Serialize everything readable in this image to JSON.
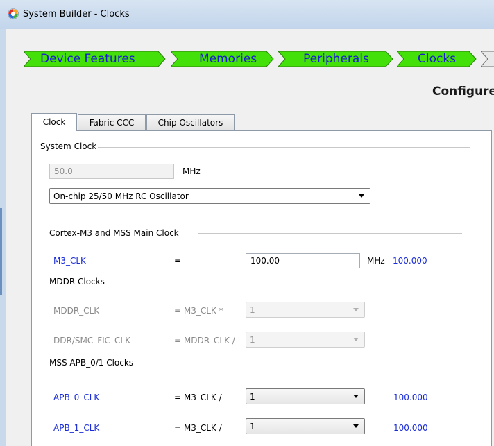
{
  "window": {
    "title": "System Builder - Clocks",
    "icon": "app-logo-icon"
  },
  "wizard": {
    "steps": [
      {
        "label": "Device Features"
      },
      {
        "label": "Memories"
      },
      {
        "label": "Peripherals"
      },
      {
        "label": "Clocks"
      }
    ],
    "heading": "Configure"
  },
  "tabs": [
    {
      "label": "Clock",
      "active": true
    },
    {
      "label": "Fabric CCC"
    },
    {
      "label": "Chip Oscillators"
    }
  ],
  "system_clock": {
    "group_label": "System Clock",
    "frequency_value": "50.0",
    "unit": "MHz",
    "source_selected": "On-chip 25/50 MHz RC Oscillator"
  },
  "m3": {
    "group_label": "Cortex-M3 and MSS Main Clock",
    "name": "M3_CLK",
    "operator": "=",
    "value": "100.00",
    "unit": "MHz",
    "actual": "100.000"
  },
  "mddr": {
    "group_label": "MDDR Clocks",
    "rows": [
      {
        "name": "MDDR_CLK",
        "expr": "= M3_CLK *",
        "selected": "1"
      },
      {
        "name": "DDR/SMC_FIC_CLK",
        "expr": "= MDDR_CLK /",
        "selected": "1"
      }
    ]
  },
  "apb": {
    "group_label": "MSS APB_0/1 Clocks",
    "rows": [
      {
        "name": "APB_0_CLK",
        "expr": "= M3_CLK /",
        "selected": "1",
        "actual": "100.000"
      },
      {
        "name": "APB_1_CLK",
        "expr": "= M3_CLK /",
        "selected": "1",
        "actual": "100.000"
      }
    ]
  },
  "colors": {
    "step_fill": "#44e00a",
    "link_blue": "#1a2cd8",
    "step_text": "#1a1ad0"
  }
}
